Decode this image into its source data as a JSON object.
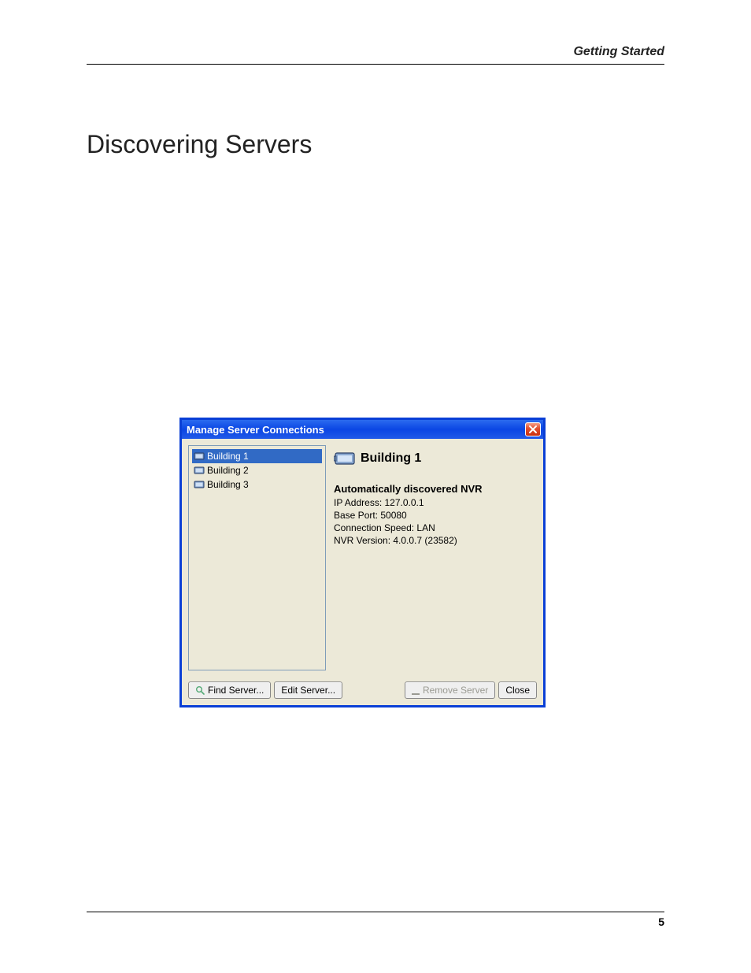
{
  "header": {
    "section": "Getting Started"
  },
  "title": "Discovering Servers",
  "dialog": {
    "title": "Manage Server Connections",
    "servers": [
      {
        "name": "Building 1",
        "selected": true
      },
      {
        "name": "Building 2",
        "selected": false
      },
      {
        "name": "Building 3",
        "selected": false
      }
    ],
    "detail": {
      "name": "Building 1",
      "heading": "Automatically discovered NVR",
      "ip_label": "IP Address: 127.0.0.1",
      "port_label": "Base Port: 50080",
      "speed_label": "Connection Speed: LAN",
      "version_label": "NVR Version: 4.0.0.7 (23582)"
    },
    "buttons": {
      "find": "Find Server...",
      "edit": "Edit Server...",
      "remove": "Remove Server",
      "close": "Close"
    }
  },
  "footer": {
    "page": "5"
  }
}
